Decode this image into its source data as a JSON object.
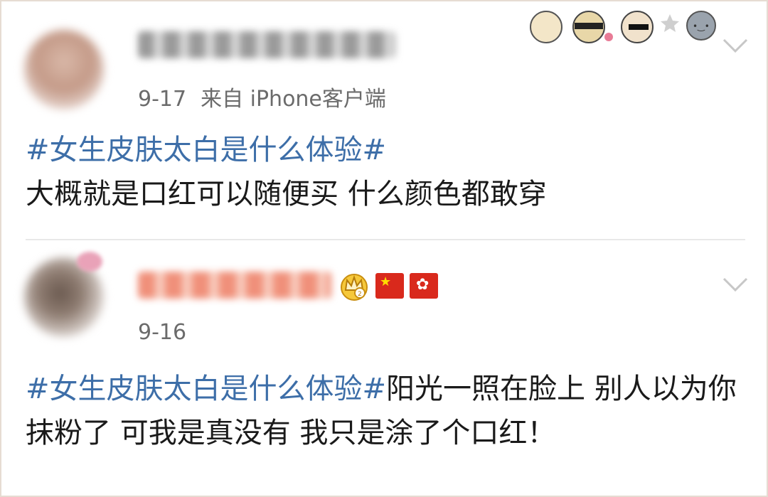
{
  "posts": [
    {
      "date": "9-17",
      "source": "来自 iPhone客户端",
      "hashtag": "#女生皮肤太白是什么体验#",
      "body": "大概就是口红可以随便买 什么颜色都敢穿"
    },
    {
      "date": "9-16",
      "source": "",
      "hashtag": "#女生皮肤太白是什么体验#",
      "body": "阳光一照在脸上 别人以为你抹粉了 可我是真没有 我只是涂了个口红！"
    }
  ],
  "icons": {
    "chevron": "chevron-down-icon",
    "crown": "crown-icon",
    "flag_1": "china-flag-icon",
    "flag_2": "hong-kong-flag-icon",
    "sticker": "cartoon-sticker-strip"
  },
  "colors": {
    "hashtag": "#3d6ea8",
    "meta": "#6b6b6b",
    "text": "#1a1a1a",
    "frame": "#e6dcd2"
  }
}
